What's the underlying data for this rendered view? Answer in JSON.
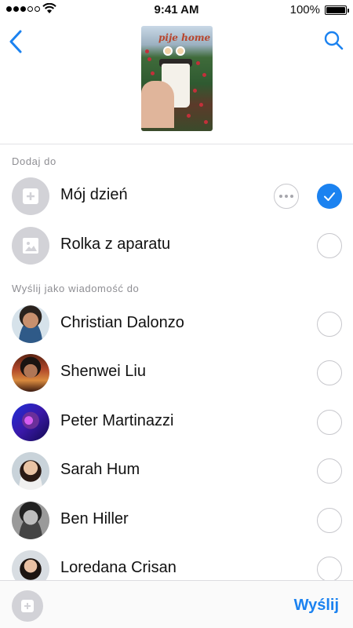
{
  "status_bar": {
    "time": "9:41 AM",
    "battery_percent": "100%",
    "signal_bars_filled": 3,
    "signal_bars_total": 5
  },
  "header": {
    "back_icon": "chevron-left-icon",
    "search_icon": "search-icon",
    "preview_sticker_text": "pije home"
  },
  "add_to": {
    "label": "Dodaj do",
    "items": [
      {
        "label": "Mój dzień",
        "icon": "plus-icon",
        "checked": true,
        "has_more": true
      },
      {
        "label": "Rolka z aparatu",
        "icon": "image-icon",
        "checked": false
      }
    ]
  },
  "send_as_message": {
    "label": "Wyślij jako wiadomość do",
    "contacts": [
      {
        "name": "Christian Dalonzo",
        "checked": false
      },
      {
        "name": "Shenwei Liu",
        "checked": false
      },
      {
        "name": "Peter Martinazzi",
        "checked": false
      },
      {
        "name": "Sarah Hum",
        "checked": false
      },
      {
        "name": "Ben Hiller",
        "checked": false
      },
      {
        "name": "Loredana Crisan",
        "checked": false
      }
    ]
  },
  "bottom_bar": {
    "send_label": "Wyślij"
  },
  "colors": {
    "accent": "#1b82f0",
    "section_text": "#8e8e93",
    "placeholder_avatar": "#d2d2d7"
  }
}
